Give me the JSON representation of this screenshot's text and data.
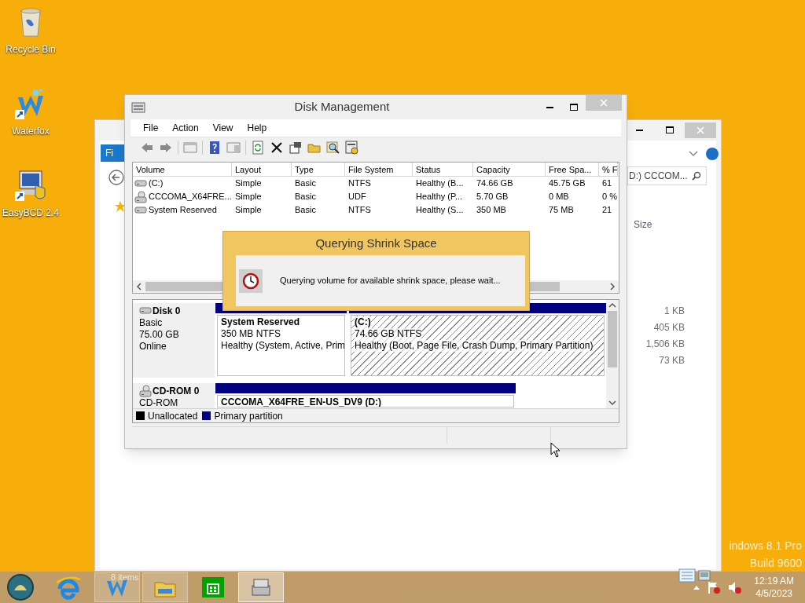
{
  "desktop_icons": [
    {
      "kind": "bin",
      "label": "Recycle Bin"
    },
    {
      "kind": "waterfox",
      "label": "Waterfox"
    },
    {
      "kind": "easybcd",
      "label": "EasyBCD 2.4"
    }
  ],
  "explorer": {
    "ribbon_tab": "Fi",
    "search_value": "D:) CCCOM...",
    "size_column": "Size",
    "sizes": [
      "1 KB",
      "405 KB",
      "1,506 KB",
      "73 KB"
    ],
    "status": "8 items"
  },
  "disk_management": {
    "title": "Disk Management",
    "menu": [
      "File",
      "Action",
      "View",
      "Help"
    ],
    "columns": [
      "Volume",
      "Layout",
      "Type",
      "File System",
      "Status",
      "Capacity",
      "Free Spa...",
      "% F"
    ],
    "rows": [
      {
        "kind": "disk",
        "cells": [
          "(C:)",
          "Simple",
          "Basic",
          "NTFS",
          "Healthy (B...",
          "74.66 GB",
          "45.75 GB",
          "61"
        ]
      },
      {
        "kind": "cd",
        "cells": [
          "CCCOMA_X64FRE...",
          "Simple",
          "Basic",
          "UDF",
          "Healthy (P...",
          "5.70 GB",
          "0 MB",
          "0 %"
        ]
      },
      {
        "kind": "disk",
        "cells": [
          "System Reserved",
          "Simple",
          "Basic",
          "NTFS",
          "Healthy (S...",
          "350 MB",
          "75 MB",
          "21"
        ]
      }
    ],
    "disks": [
      {
        "kind": "disk",
        "name": "Disk 0",
        "details": [
          "Basic",
          "75.00 GB",
          "Online"
        ],
        "partitions": [
          {
            "name": "System Reserved",
            "info": "350 MB NTFS",
            "status": "Healthy (System, Active, Prim",
            "selected": false
          },
          {
            "name": "(C:)",
            "info": "74.66 GB NTFS",
            "status": "Healthy (Boot, Page File, Crash Dump, Primary Partition)",
            "selected": true
          }
        ]
      },
      {
        "kind": "cd",
        "name": "CD-ROM 0",
        "details": [
          "CD-ROM"
        ],
        "partitions": [
          {
            "name": "CCCOMA_X64FRE_EN-US_DV9  (D:)",
            "selected": false
          }
        ]
      }
    ],
    "legend": [
      {
        "label": "Unallocated",
        "color": "#000000"
      },
      {
        "label": "Primary partition",
        "color": "#000080"
      }
    ]
  },
  "dialog": {
    "title": "Querying Shrink Space",
    "message": "Querying volume for available shrink space, please wait..."
  },
  "watermark": {
    "edition": "indows 8.1 Pro",
    "build": "Build 9600"
  },
  "clock": {
    "time": "12:19 AM",
    "date": "4/5/2023"
  }
}
